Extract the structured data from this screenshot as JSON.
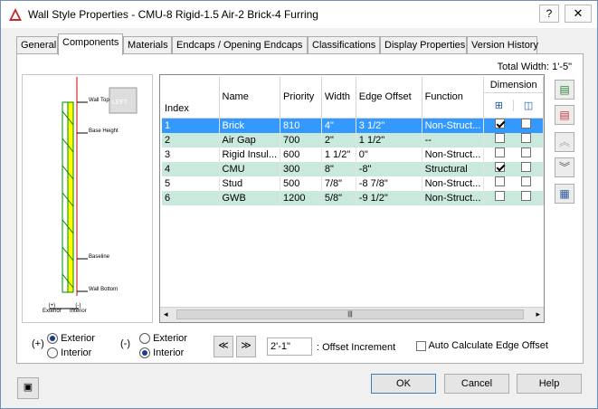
{
  "window": {
    "title": "Wall Style Properties - CMU-8 Rigid-1.5 Air-2 Brick-4 Furring",
    "help_label": "?",
    "close_label": "✕"
  },
  "tabs": [
    "General",
    "Components",
    "Materials",
    "Endcaps / Opening Endcaps",
    "Classifications",
    "Display Properties",
    "Version History"
  ],
  "total_width": "Total Width: 1'-5\"",
  "preview": {
    "view_label": "LEFT",
    "labels": {
      "wall_top": "Wall Top",
      "base_height": "Base Height",
      "baseline": "Baseline",
      "wall_bottom": "Wall Bottom",
      "exterior": "(+)\nExterior",
      "interior": "(-)\nInterior"
    }
  },
  "grid": {
    "columns": [
      "Index",
      "Name",
      "Priority",
      "Width",
      "Edge Offset",
      "Function",
      "Dimension"
    ],
    "rows": [
      {
        "index": "1",
        "name": "Brick",
        "priority": "810",
        "width": "4\"",
        "edge_offset": "3 1/2\"",
        "function": "Non-Struct...",
        "dim1": true,
        "dim2": false
      },
      {
        "index": "2",
        "name": "Air Gap",
        "priority": "700",
        "width": "2\"",
        "edge_offset": "1 1/2\"",
        "function": "--",
        "dim1": false,
        "dim2": false
      },
      {
        "index": "3",
        "name": "Rigid Insul...",
        "priority": "600",
        "width": "1 1/2\"",
        "edge_offset": "0\"",
        "function": "Non-Struct...",
        "dim1": false,
        "dim2": false
      },
      {
        "index": "4",
        "name": "CMU",
        "priority": "300",
        "width": "8\"",
        "edge_offset": "-8\"",
        "function": "Structural",
        "dim1": true,
        "dim2": false
      },
      {
        "index": "5",
        "name": "Stud",
        "priority": "500",
        "width": "7/8\"",
        "edge_offset": "-8 7/8\"",
        "function": "Non-Struct...",
        "dim1": false,
        "dim2": false
      },
      {
        "index": "6",
        "name": "GWB",
        "priority": "1200",
        "width": "5/8\"",
        "edge_offset": "-9 1/2\"",
        "function": "Non-Struct...",
        "dim1": false,
        "dim2": false
      }
    ]
  },
  "options": {
    "plus_label": "(+)",
    "minus_label": "(-)",
    "exterior": "Exterior",
    "interior": "Interior"
  },
  "offset": {
    "value": "2'-1\"",
    "label": ": Offset Increment",
    "auto_label": "Auto Calculate Edge Offset"
  },
  "buttons": {
    "ok": "OK",
    "cancel": "Cancel",
    "help": "Help"
  }
}
